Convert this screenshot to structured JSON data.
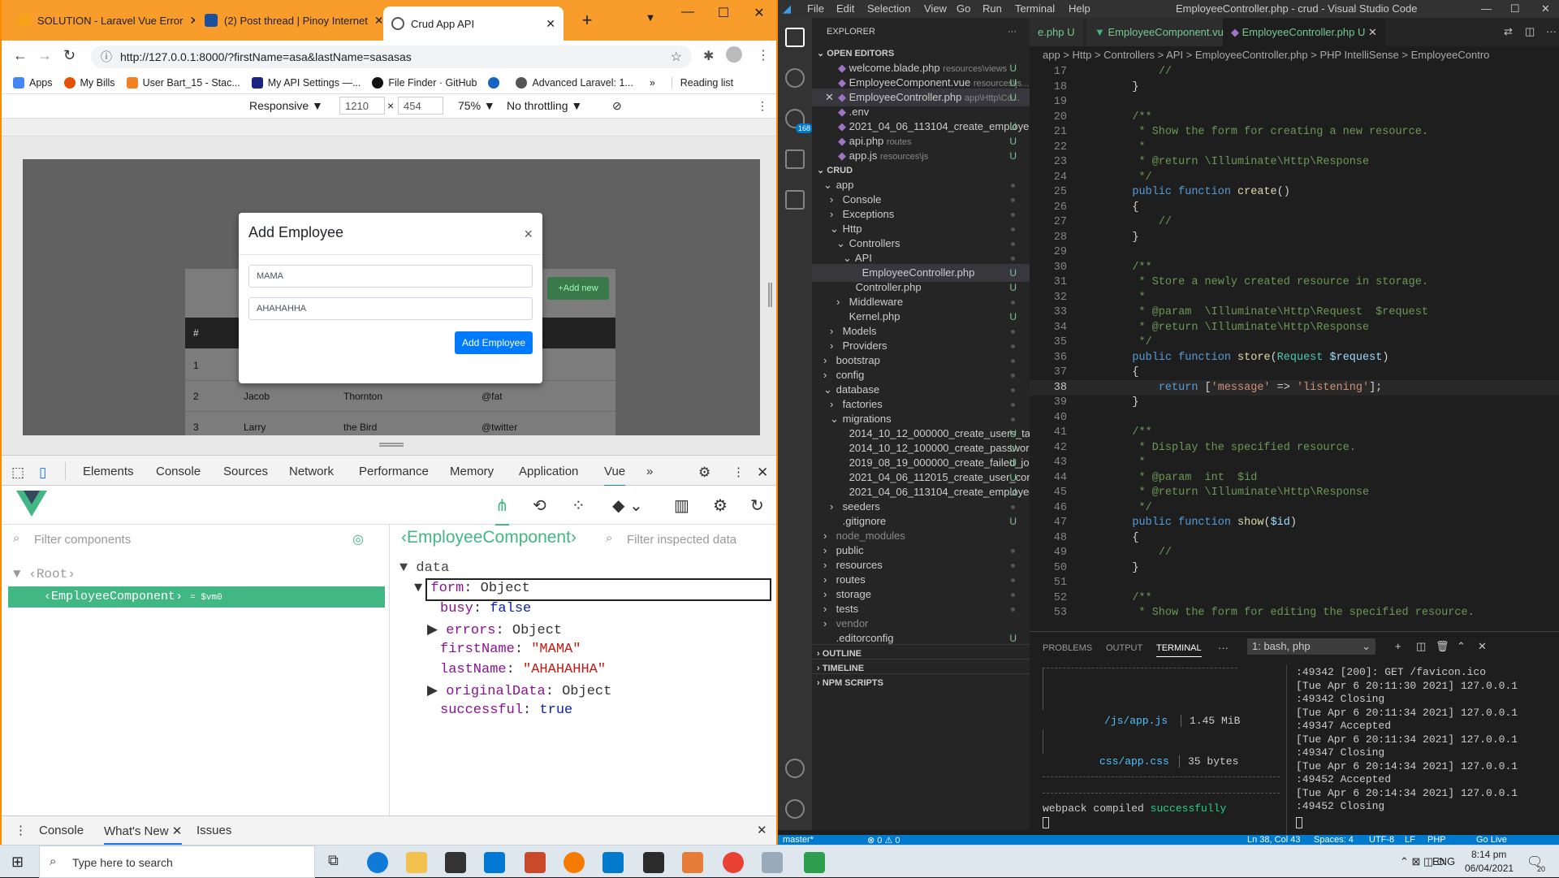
{
  "browser": {
    "tabs": [
      {
        "title": "SOLUTION - Laravel Vue Error",
        "color": "#f7a21b"
      },
      {
        "title": "(2) Post thread | Pinoy Internet",
        "color": "#1d4f9c"
      },
      {
        "title": "Crud App API",
        "color": "#4a4a4a"
      }
    ],
    "new_tab": "+",
    "url": "http://127.0.0.1:8000/?firstName=asa&lastName=sasasas",
    "bookmarks": [
      "Apps",
      "My Bills",
      "User Bart_15 - Stac...",
      "My API Settings —...",
      "File Finder · GitHub",
      "Advanced Laravel: 1..."
    ],
    "more_bookmarks": "»",
    "reading_list": "Reading list",
    "device": {
      "mode": "Responsive",
      "width": "1210",
      "height": "454",
      "times": "×",
      "zoom": "75%",
      "throttling": "No throttling"
    }
  },
  "app": {
    "modal_title": "Add Employee",
    "close": "×",
    "first_name": "MAMA",
    "last_name": "AHAHAHHA",
    "submit": "Add Employee",
    "add_new": "+Add new",
    "table_header": "#",
    "rows": [
      {
        "num": "1",
        "first": "",
        "last": "",
        "handle": ""
      },
      {
        "num": "2",
        "first": "Jacob",
        "last": "Thornton",
        "handle": "@fat"
      },
      {
        "num": "3",
        "first": "Larry",
        "last": "the Bird",
        "handle": "@twitter"
      }
    ]
  },
  "devtools": {
    "tabs": [
      "Elements",
      "Console",
      "Sources",
      "Network",
      "Performance",
      "Memory",
      "Application",
      "Vue"
    ],
    "more": "»",
    "filter_components": "Filter components",
    "root": "Root",
    "selected_component": "EmployeeComponent",
    "vm": "= $vm0",
    "inspected_component": "EmployeeComponent",
    "filter_inspected": "Filter inspected data",
    "data_label": "data",
    "data": {
      "form": "form",
      "form_type": "Object",
      "busy_key": "busy",
      "busy": "false",
      "errors_key": "errors",
      "errors_type": "Object",
      "first_key": "firstName",
      "first": "\"MAMA\"",
      "last_key": "lastName",
      "last": "\"AHAHAHHA\"",
      "orig_key": "originalData",
      "orig_type": "Object",
      "succ_key": "successful",
      "succ": "true"
    },
    "drawer_tabs": [
      "Console",
      "What's New",
      "Issues"
    ]
  },
  "vscode": {
    "menu": [
      "File",
      "Edit",
      "Selection",
      "View",
      "Go",
      "Run",
      "Terminal",
      "Help"
    ],
    "title": "EmployeeController.php - crud - Visual Studio Code",
    "editor_tabs": [
      {
        "label": "e.php",
        "status": "U"
      },
      {
        "label": "EmployeeComponent.vue",
        "status": "U"
      },
      {
        "label": "EmployeeController.php",
        "status": "U"
      }
    ],
    "breadcrumb": "app > Http > Controllers > API > EmployeeController.php > PHP IntelliSense > EmployeeContro",
    "explorer_title": "EXPLORER",
    "open_editors_title": "OPEN EDITORS",
    "open_editors": [
      {
        "name": "welcome.blade.php",
        "path": "resources\\views",
        "status": "U"
      },
      {
        "name": "EmployeeComponent.vue",
        "path": "resources\\js...",
        "status": "U"
      },
      {
        "name": "EmployeeController.php",
        "path": "app\\Http\\Co...",
        "status": "U"
      },
      {
        "name": ".env",
        "path": "",
        "status": ""
      },
      {
        "name": "2021_04_06_113104_create_employe...",
        "path": "",
        "status": "U"
      },
      {
        "name": "api.php",
        "path": "routes",
        "status": "U"
      },
      {
        "name": "app.js",
        "path": "resources\\js",
        "status": "U"
      }
    ],
    "project_title": "CRUD",
    "tree": [
      {
        "name": "app",
        "depth": 0,
        "caret": "⌄",
        "status": "•"
      },
      {
        "name": "Console",
        "depth": 1,
        "caret": "›",
        "status": "•"
      },
      {
        "name": "Exceptions",
        "depth": 1,
        "caret": "›",
        "status": "•"
      },
      {
        "name": "Http",
        "depth": 1,
        "caret": "⌄",
        "status": "•"
      },
      {
        "name": "Controllers",
        "depth": 2,
        "caret": "⌄",
        "status": "•"
      },
      {
        "name": "API",
        "depth": 3,
        "caret": "⌄",
        "status": "•"
      },
      {
        "name": "EmployeeController.php",
        "depth": 4,
        "caret": "",
        "status": "U"
      },
      {
        "name": "Controller.php",
        "depth": 3,
        "caret": "",
        "status": "U"
      },
      {
        "name": "Middleware",
        "depth": 2,
        "caret": "›",
        "status": "•"
      },
      {
        "name": "Kernel.php",
        "depth": 2,
        "caret": "",
        "status": "U"
      },
      {
        "name": "Models",
        "depth": 1,
        "caret": "›",
        "status": "•"
      },
      {
        "name": "Providers",
        "depth": 1,
        "caret": "›",
        "status": "•"
      },
      {
        "name": "bootstrap",
        "depth": 0,
        "caret": "›",
        "status": "•"
      },
      {
        "name": "config",
        "depth": 0,
        "caret": "›",
        "status": "•"
      },
      {
        "name": "database",
        "depth": 0,
        "caret": "⌄",
        "status": "•"
      },
      {
        "name": "factories",
        "depth": 1,
        "caret": "›",
        "status": "•"
      },
      {
        "name": "migrations",
        "depth": 1,
        "caret": "⌄",
        "status": "•"
      },
      {
        "name": "2014_10_12_000000_create_users_tabl...",
        "depth": 2,
        "caret": "",
        "status": "U"
      },
      {
        "name": "2014_10_12_100000_create_password_...",
        "depth": 2,
        "caret": "",
        "status": "U"
      },
      {
        "name": "2019_08_19_000000_create_failed_jobs...",
        "depth": 2,
        "caret": "",
        "status": "U"
      },
      {
        "name": "2021_04_06_112015_create_user_contr...",
        "depth": 2,
        "caret": "",
        "status": "U"
      },
      {
        "name": "2021_04_06_113104_create_employees...",
        "depth": 2,
        "caret": "",
        "status": "U"
      },
      {
        "name": "seeders",
        "depth": 1,
        "caret": "›",
        "status": "•"
      },
      {
        "name": ".gitignore",
        "depth": 1,
        "caret": "",
        "status": "U"
      },
      {
        "name": "node_modules",
        "depth": 0,
        "caret": "›",
        "status": ""
      },
      {
        "name": "public",
        "depth": 0,
        "caret": "›",
        "status": "•"
      },
      {
        "name": "resources",
        "depth": 0,
        "caret": "›",
        "status": "•"
      },
      {
        "name": "routes",
        "depth": 0,
        "caret": "›",
        "status": "•"
      },
      {
        "name": "storage",
        "depth": 0,
        "caret": "›",
        "status": "•"
      },
      {
        "name": "tests",
        "depth": 0,
        "caret": "›",
        "status": "•"
      },
      {
        "name": "vendor",
        "depth": 0,
        "caret": "›",
        "status": ""
      },
      {
        "name": ".editorconfig",
        "depth": 0,
        "caret": "",
        "status": "U"
      }
    ],
    "outline": "OUTLINE",
    "timeline": "TIMELINE",
    "npm": "NPM SCRIPTS",
    "code": [
      {
        "n": "17",
        "html": "        <span class='cm'>//</span>"
      },
      {
        "n": "18",
        "html": "    }"
      },
      {
        "n": "19",
        "html": ""
      },
      {
        "n": "20",
        "html": "    <span class='cm'>/**</span>"
      },
      {
        "n": "21",
        "html": "<span class='cm'>     * Show the form for creating a new resource.</span>"
      },
      {
        "n": "22",
        "html": "<span class='cm'>     *</span>"
      },
      {
        "n": "23",
        "html": "<span class='cm'>     * @return \\Illuminate\\Http\\Response</span>"
      },
      {
        "n": "24",
        "html": "<span class='cm'>     */</span>"
      },
      {
        "n": "25",
        "html": "    <span class='kw'>public function</span> <span class='fn'>create</span>()"
      },
      {
        "n": "26",
        "html": "    {"
      },
      {
        "n": "27",
        "html": "        <span class='cm'>//</span>"
      },
      {
        "n": "28",
        "html": "    }"
      },
      {
        "n": "29",
        "html": ""
      },
      {
        "n": "30",
        "html": "    <span class='cm'>/**</span>"
      },
      {
        "n": "31",
        "html": "<span class='cm'>     * Store a newly created resource in storage.</span>"
      },
      {
        "n": "32",
        "html": "<span class='cm'>     *</span>"
      },
      {
        "n": "33",
        "html": "<span class='cm'>     * @param  \\Illuminate\\Http\\Request  $request</span>"
      },
      {
        "n": "34",
        "html": "<span class='cm'>     * @return \\Illuminate\\Http\\Response</span>"
      },
      {
        "n": "35",
        "html": "<span class='cm'>     */</span>"
      },
      {
        "n": "36",
        "html": "    <span class='kw'>public function</span> <span class='fn'>store</span>(<span class='ty'>Request</span> <span class='vr'>$request</span>)"
      },
      {
        "n": "37",
        "html": "    {"
      },
      {
        "n": "38",
        "html": "        <span class='kw'>return</span> [<span class='str'>'message'</span> =&gt; <span class='str'>'listening'</span>];"
      },
      {
        "n": "39",
        "html": "    }"
      },
      {
        "n": "40",
        "html": ""
      },
      {
        "n": "41",
        "html": "    <span class='cm'>/**</span>"
      },
      {
        "n": "42",
        "html": "<span class='cm'>     * Display the specified resource.</span>"
      },
      {
        "n": "43",
        "html": "<span class='cm'>     *</span>"
      },
      {
        "n": "44",
        "html": "<span class='cm'>     * @param  int  $id</span>"
      },
      {
        "n": "45",
        "html": "<span class='cm'>     * @return \\Illuminate\\Http\\Response</span>"
      },
      {
        "n": "46",
        "html": "<span class='cm'>     */</span>"
      },
      {
        "n": "47",
        "html": "    <span class='kw'>public function</span> <span class='fn'>show</span>(<span class='vr'>$id</span>)"
      },
      {
        "n": "48",
        "html": "    {"
      },
      {
        "n": "49",
        "html": "        <span class='cm'>//</span>"
      },
      {
        "n": "50",
        "html": "    }"
      },
      {
        "n": "51",
        "html": ""
      },
      {
        "n": "52",
        "html": "    <span class='cm'>/**</span>"
      },
      {
        "n": "53",
        "html": "<span class='cm'>     * Show the form for editing the specified resource.</span>"
      }
    ],
    "panel_tabs": [
      "PROBLEMS",
      "OUTPUT",
      "TERMINAL"
    ],
    "terminal_select": "1: bash, php",
    "webpack": {
      "asset1": "/js/app.js",
      "size1": "1.45 MiB",
      "asset2": "css/app.css",
      "size2": "35 bytes",
      "done_prefix": "webpack compiled",
      "done_word": "successfully"
    },
    "server_log": [
      ":49342 [200]: GET /favicon.ico",
      "[Tue Apr  6 20:11:30 2021] 127.0.0.1",
      ":49342 Closing",
      "[Tue Apr  6 20:11:34 2021] 127.0.0.1",
      ":49347 Accepted",
      "[Tue Apr  6 20:11:34 2021] 127.0.0.1",
      ":49347 Closing",
      "[Tue Apr  6 20:14:34 2021] 127.0.0.1",
      ":49452 Accepted",
      "[Tue Apr  6 20:14:34 2021] 127.0.0.1",
      ":49452 Closing"
    ],
    "status": {
      "branch": "master*",
      "errors": "⊗ 0 ⚠ 0",
      "position": "Ln 38, Col 43",
      "spaces": "Spaces: 4",
      "encoding": "UTF-8",
      "eol": "LF",
      "lang": "PHP",
      "live": "Go Live"
    }
  },
  "taskbar": {
    "search_placeholder": "Type here to search",
    "lang": "ENG",
    "time": "8:14 pm",
    "date": "06/04/2021",
    "notif": "20"
  }
}
